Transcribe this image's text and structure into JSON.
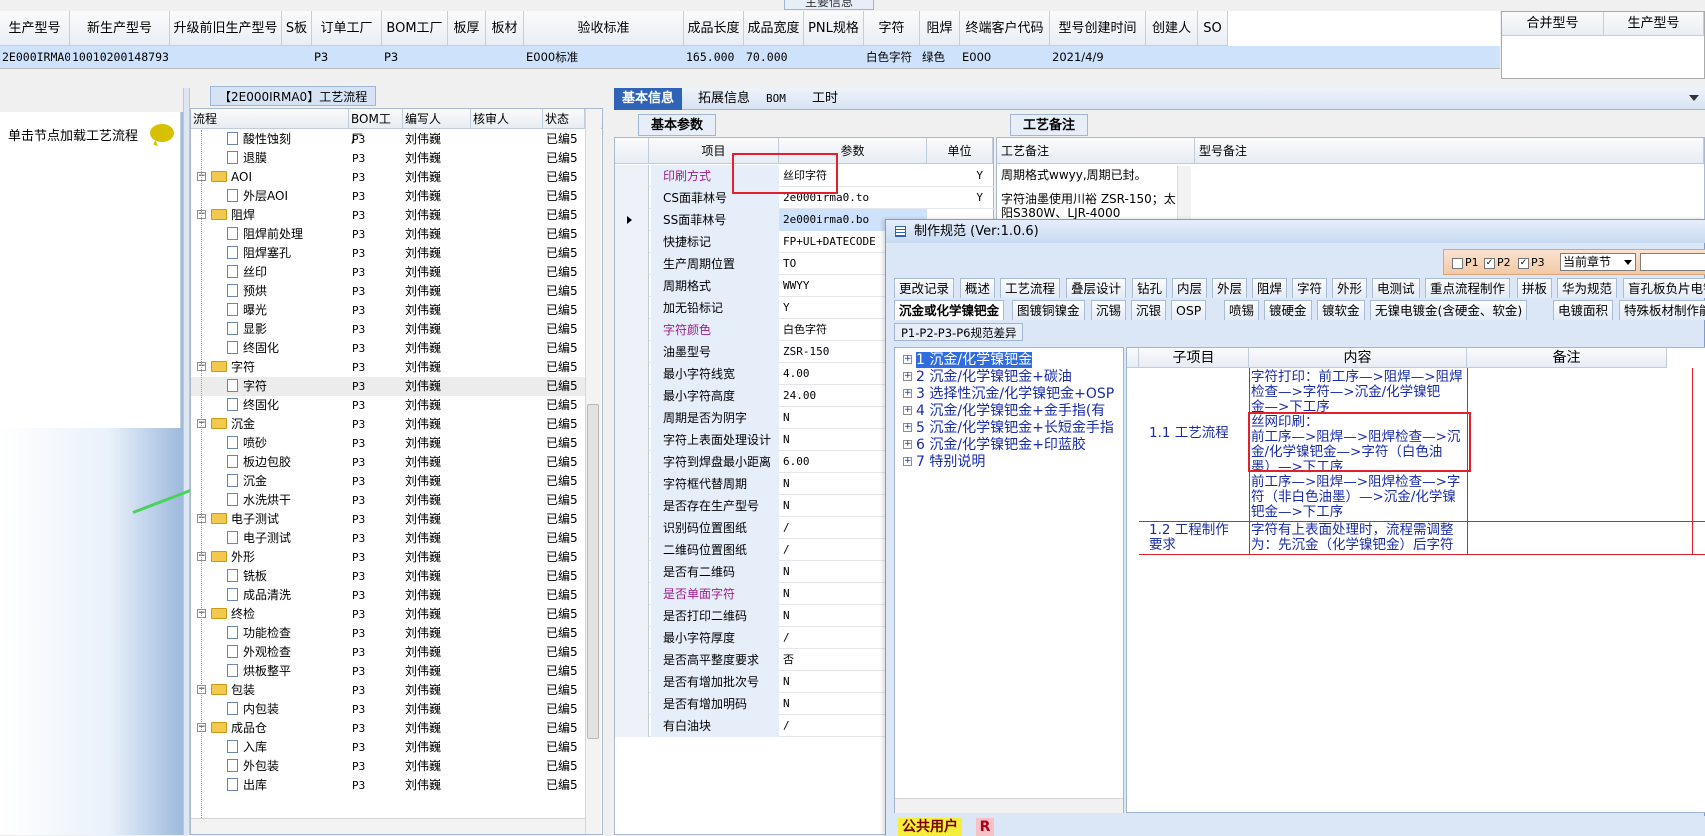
{
  "main_info_label": "主要信息",
  "top_grid": {
    "headers": [
      "生产型号",
      "新生产型号",
      "升级前旧生产型号",
      "S板",
      "订单工厂",
      "BOM工厂",
      "板厚",
      "板材",
      "验收标准",
      "成品长度",
      "成品宽度",
      "PNL规格",
      "字符",
      "阻焊",
      "终端客户代码",
      "型号创建时间",
      "创建人",
      "SO"
    ],
    "row": [
      "2E000IRMA0",
      "10010200148793",
      "",
      "",
      "P3",
      "P3",
      "",
      "",
      "E000标准",
      "165.000",
      "70.000",
      "",
      "白色字符",
      "绿色",
      "E000",
      "2021/4/9",
      "",
      ""
    ],
    "merge_headers": [
      "合并型号",
      "生产型号"
    ]
  },
  "left_panel": {
    "hint": "单击节点加载工艺流程"
  },
  "tree": {
    "title": "【2E000IRMA0】工艺流程",
    "headers": [
      "流程",
      "BOM工厂",
      "编写人",
      "核审人",
      "状态"
    ],
    "rows": [
      {
        "type": "leaf",
        "name": "酸性蚀刻",
        "bom": "P3",
        "writer": "刘伟巍",
        "status": "已编5"
      },
      {
        "type": "leaf",
        "name": "退膜",
        "bom": "P3",
        "writer": "刘伟巍",
        "status": "已编5"
      },
      {
        "type": "folder",
        "name": "AOI",
        "bom": "P3",
        "writer": "刘伟巍",
        "status": "已编5"
      },
      {
        "type": "leaf",
        "name": "外层AOI",
        "bom": "P3",
        "writer": "刘伟巍",
        "status": "已编5"
      },
      {
        "type": "folder",
        "name": "阻焊",
        "bom": "P3",
        "writer": "刘伟巍",
        "status": "已编5"
      },
      {
        "type": "leaf",
        "name": "阻焊前处理",
        "bom": "P3",
        "writer": "刘伟巍",
        "status": "已编5"
      },
      {
        "type": "leaf",
        "name": "阻焊塞孔",
        "bom": "P3",
        "writer": "刘伟巍",
        "status": "已编5"
      },
      {
        "type": "leaf",
        "name": "丝印",
        "bom": "P3",
        "writer": "刘伟巍",
        "status": "已编5"
      },
      {
        "type": "leaf",
        "name": "预烘",
        "bom": "P3",
        "writer": "刘伟巍",
        "status": "已编5"
      },
      {
        "type": "leaf",
        "name": "曝光",
        "bom": "P3",
        "writer": "刘伟巍",
        "status": "已编5"
      },
      {
        "type": "leaf",
        "name": "显影",
        "bom": "P3",
        "writer": "刘伟巍",
        "status": "已编5"
      },
      {
        "type": "leaf",
        "name": "终固化",
        "bom": "P3",
        "writer": "刘伟巍",
        "status": "已编5"
      },
      {
        "type": "folder",
        "name": "字符",
        "bom": "P3",
        "writer": "刘伟巍",
        "status": "已编5"
      },
      {
        "type": "leaf",
        "name": "字符",
        "bom": "P3",
        "writer": "刘伟巍",
        "status": "已编5",
        "selected": true
      },
      {
        "type": "leaf",
        "name": "终固化",
        "bom": "P3",
        "writer": "刘伟巍",
        "status": "已编5"
      },
      {
        "type": "folder",
        "name": "沉金",
        "bom": "P3",
        "writer": "刘伟巍",
        "status": "已编5"
      },
      {
        "type": "leaf",
        "name": "喷砂",
        "bom": "P3",
        "writer": "刘伟巍",
        "status": "已编5"
      },
      {
        "type": "leaf",
        "name": "板边包胶",
        "bom": "P3",
        "writer": "刘伟巍",
        "status": "已编5"
      },
      {
        "type": "leaf",
        "name": "沉金",
        "bom": "P3",
        "writer": "刘伟巍",
        "status": "已编5"
      },
      {
        "type": "leaf",
        "name": "水洗烘干",
        "bom": "P3",
        "writer": "刘伟巍",
        "status": "已编5"
      },
      {
        "type": "folder",
        "name": "电子测试",
        "bom": "P3",
        "writer": "刘伟巍",
        "status": "已编5"
      },
      {
        "type": "leaf",
        "name": "电子测试",
        "bom": "P3",
        "writer": "刘伟巍",
        "status": "已编5"
      },
      {
        "type": "folder",
        "name": "外形",
        "bom": "P3",
        "writer": "刘伟巍",
        "status": "已编5"
      },
      {
        "type": "leaf",
        "name": "铣板",
        "bom": "P3",
        "writer": "刘伟巍",
        "status": "已编5"
      },
      {
        "type": "leaf",
        "name": "成品清洗",
        "bom": "P3",
        "writer": "刘伟巍",
        "status": "已编5"
      },
      {
        "type": "folder",
        "name": "终检",
        "bom": "P3",
        "writer": "刘伟巍",
        "status": "已编5"
      },
      {
        "type": "leaf",
        "name": "功能检查",
        "bom": "P3",
        "writer": "刘伟巍",
        "status": "已编5"
      },
      {
        "type": "leaf",
        "name": "外观检查",
        "bom": "P3",
        "writer": "刘伟巍",
        "status": "已编5"
      },
      {
        "type": "leaf",
        "name": "烘板整平",
        "bom": "P3",
        "writer": "刘伟巍",
        "status": "已编5"
      },
      {
        "type": "folder",
        "name": "包装",
        "bom": "P3",
        "writer": "刘伟巍",
        "status": "已编5"
      },
      {
        "type": "leaf",
        "name": "内包装",
        "bom": "P3",
        "writer": "刘伟巍",
        "status": "已编5"
      },
      {
        "type": "folder",
        "name": "成品仓",
        "bom": "P3",
        "writer": "刘伟巍",
        "status": "已编5"
      },
      {
        "type": "leaf",
        "name": "入库",
        "bom": "P3",
        "writer": "刘伟巍",
        "status": "已编5"
      },
      {
        "type": "leaf",
        "name": "外包装",
        "bom": "P3",
        "writer": "刘伟巍",
        "status": "已编5"
      },
      {
        "type": "leaf",
        "name": "出库",
        "bom": "P3",
        "writer": "刘伟巍",
        "status": "已编5"
      }
    ]
  },
  "tabs": [
    "基本信息",
    "拓展信息",
    "BOM",
    "工时"
  ],
  "basic_params": {
    "title": "基本参数",
    "headers": [
      "项目",
      "参数",
      "单位"
    ],
    "rows": [
      {
        "name": "印刷方式",
        "value": "丝印字符",
        "unit": "Y",
        "purple": true
      },
      {
        "name": "CS面菲林号",
        "value": "2e000irma0.to",
        "unit": "Y"
      },
      {
        "name": "SS面菲林号",
        "value": "2e000irma0.bo",
        "unit": "",
        "current": true
      },
      {
        "name": "快捷标记",
        "value": "FP+UL+DATECODE",
        "unit": ""
      },
      {
        "name": "生产周期位置",
        "value": "TO",
        "unit": ""
      },
      {
        "name": "周期格式",
        "value": "WWYY",
        "unit": ""
      },
      {
        "name": "加无铅标记",
        "value": "Y",
        "unit": ""
      },
      {
        "name": "字符颜色",
        "value": "白色字符",
        "unit": "",
        "purple": true
      },
      {
        "name": "油墨型号",
        "value": "ZSR-150",
        "unit": ""
      },
      {
        "name": "最小字符线宽",
        "value": "4.00",
        "unit": ""
      },
      {
        "name": "最小字符高度",
        "value": "24.00",
        "unit": ""
      },
      {
        "name": "周期是否为阴字",
        "value": "N",
        "unit": ""
      },
      {
        "name": "字符上表面处理设计",
        "value": "N",
        "unit": ""
      },
      {
        "name": "字符到焊盘最小距离",
        "value": "6.00",
        "unit": ""
      },
      {
        "name": "字符框代替周期",
        "value": "N",
        "unit": ""
      },
      {
        "name": "是否存在生产型号",
        "value": "N",
        "unit": ""
      },
      {
        "name": "识别码位置图纸",
        "value": "/",
        "unit": ""
      },
      {
        "name": "二维码位置图纸",
        "value": "/",
        "unit": ""
      },
      {
        "name": "是否有二维码",
        "value": "N",
        "unit": ""
      },
      {
        "name": "是否单面字符",
        "value": "N",
        "unit": "",
        "purple": true
      },
      {
        "name": "是否打印二维码",
        "value": "N",
        "unit": ""
      },
      {
        "name": "最小字符厚度",
        "value": "/",
        "unit": ""
      },
      {
        "name": "是否高平整度要求",
        "value": "否",
        "unit": ""
      },
      {
        "name": "是否有增加批次号",
        "value": "N",
        "unit": ""
      },
      {
        "name": "是否有增加明码",
        "value": "N",
        "unit": ""
      },
      {
        "name": "有白油块",
        "value": "/",
        "unit": ""
      }
    ]
  },
  "remarks": {
    "title": "工艺备注",
    "headers": [
      "工艺备注",
      "型号备注"
    ],
    "lines": [
      "周期格式wwyy,周期已封。",
      "字符油墨使用川裕 ZSR-150；太",
      "阳S380W、LJR-4000"
    ]
  },
  "dialog": {
    "title": "制作规范 (Ver:1.0.6)",
    "checks": [
      "P1",
      "P2",
      "P3"
    ],
    "chapter": "当前章节",
    "tabs_row1": [
      "更改记录",
      "概述",
      "工艺流程",
      "叠层设计",
      "钻孔",
      "内层",
      "外层",
      "阻焊",
      "字符",
      "外形",
      "电测试",
      "重点流程制作",
      "拼板",
      "华为规范",
      "盲孔板负片电镀"
    ],
    "tabs_row2": [
      "沉金或化学镍钯金",
      "图镀铜镍金",
      "沉锡",
      "沉银",
      "OSP",
      "喷锡",
      "镀硬金",
      "镀软金",
      "无镍电镀金(含硬金、软金)",
      "电镀面积",
      "特殊板材制作能力",
      "CA"
    ],
    "std_diff": "P1-P2-P3-P6规范差异",
    "tree": [
      {
        "num": "1",
        "label": "沉金/化学镍钯金",
        "selected": true
      },
      {
        "num": "2",
        "label": "沉金/化学镍钯金+碳油"
      },
      {
        "num": "3",
        "label": "选择性沉金/化学镍钯金+OSP"
      },
      {
        "num": "4",
        "label": "沉金/化学镍钯金+金手指(有"
      },
      {
        "num": "5",
        "label": "沉金/化学镍钯金+长短金手指"
      },
      {
        "num": "6",
        "label": "沉金/化学镍钯金+印蓝胶"
      },
      {
        "num": "7",
        "label": "特别说明"
      }
    ],
    "grid_headers": [
      "子项目",
      "内容",
      "备注"
    ],
    "grid_rows": [
      {
        "sub": "1.1 工艺流程",
        "content": [
          "字符打印：前工序—>阻焊—>阻焊",
          "检查—>字符—>沉金/化学镍钯",
          "金—>下工序",
          "丝网印刷：",
          "前工序—>阻焊—>阻焊检查—>沉",
          "金/化学镍钯金—>字符（白色油",
          "墨）—>下工序",
          "前工序—>阻焊—>阻焊检查—>字",
          "符（非白色油墨）—>沉金/化学镍",
          "钯金—>下工序"
        ]
      },
      {
        "sub": [
          "1.2 工程制作",
          "要求"
        ],
        "content": [
          "字符有上表面处理时，流程需调整",
          "为：先沉金（化学镍钯金）后字符"
        ]
      }
    ],
    "public_user": "公共用户",
    "r_badge": "R"
  },
  "colors": {
    "accent": "#2e63b8",
    "highlight_row": "#cfe2fb",
    "annotation_red": "#e0202a",
    "arrow_green": "#4ad25a",
    "dialog_text": "#1a2cab"
  }
}
